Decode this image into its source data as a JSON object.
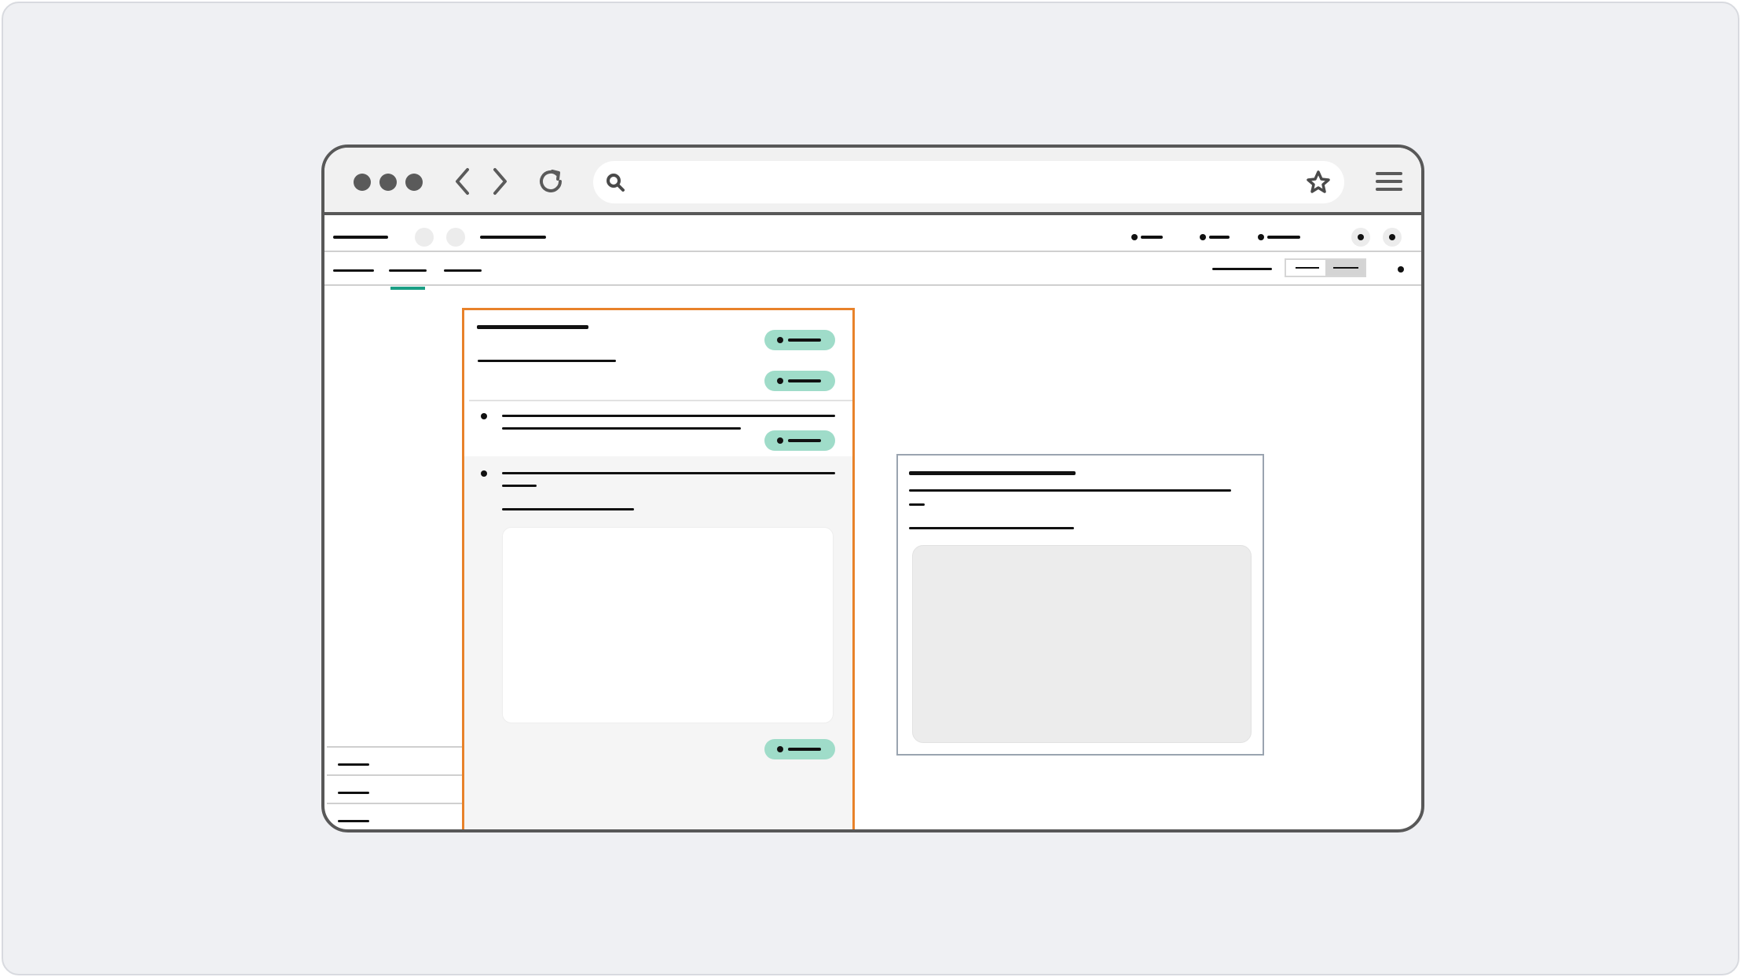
{
  "window": {
    "title": "",
    "url": ""
  },
  "icons": {
    "traffic_lights": "window-dots-icon",
    "back": "chevron-left-icon",
    "forward": "chevron-right-icon",
    "reload": "reload-icon",
    "search": "search-icon",
    "bookmark": "star-icon",
    "menu": "hamburger-menu-icon"
  },
  "colors": {
    "accent_teal": "#1a9e84",
    "badge_bg": "#9fdcc9",
    "panel_border": "#e8822a",
    "chrome_border": "#585858"
  },
  "app_header": {
    "brand": "",
    "nav_items": [
      "",
      "",
      ""
    ]
  },
  "tabs": {
    "items": [
      "",
      "",
      ""
    ],
    "active_index": 1
  },
  "sidebar": {
    "items": [
      "",
      "",
      ""
    ]
  },
  "panel": {
    "title": "",
    "subtitle": "",
    "badges": [
      "",
      "",
      "",
      ""
    ],
    "list_items": [
      "",
      ""
    ]
  },
  "preview": {
    "title": "",
    "body": "",
    "caption": ""
  }
}
